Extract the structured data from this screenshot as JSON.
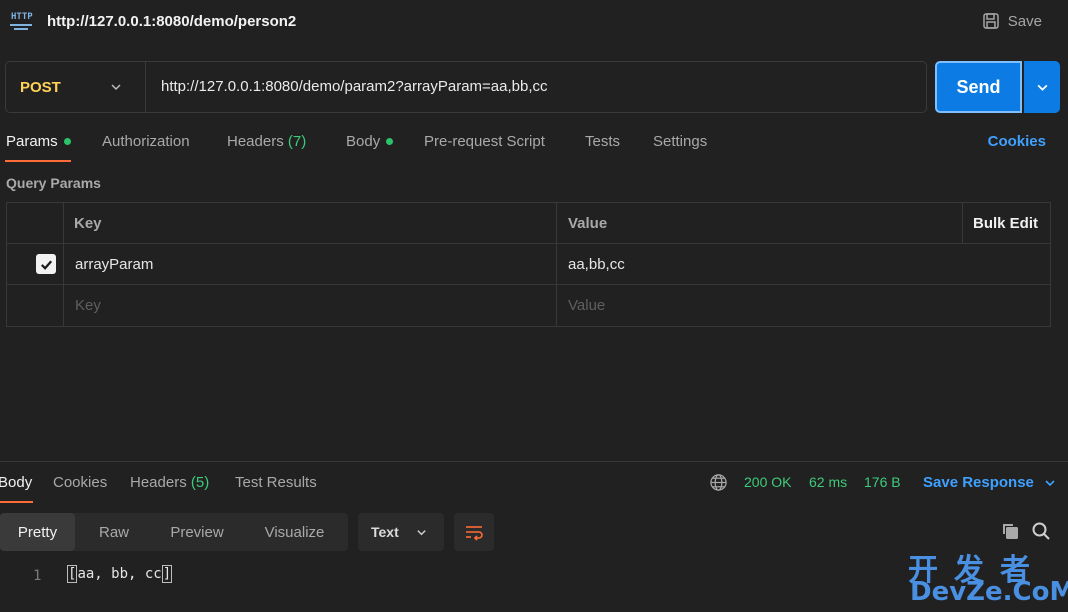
{
  "header": {
    "icon_label": "HTTP",
    "title": "http://127.0.0.1:8080/demo/person2",
    "save_label": "Save"
  },
  "request": {
    "method": "POST",
    "url": "http://127.0.0.1:8080/demo/param2?arrayParam=aa,bb,cc",
    "send_label": "Send"
  },
  "tabs": [
    {
      "label": "Params",
      "dot": true
    },
    {
      "label": "Authorization"
    },
    {
      "label": "Headers",
      "count": "(7)"
    },
    {
      "label": "Body",
      "dot": true
    },
    {
      "label": "Pre-request Script"
    },
    {
      "label": "Tests"
    },
    {
      "label": "Settings"
    }
  ],
  "cookies_label": "Cookies",
  "query_params": {
    "section_label": "Query Params",
    "key_header": "Key",
    "value_header": "Value",
    "bulk_edit_label": "Bulk Edit",
    "rows": [
      {
        "key": "arrayParam",
        "value": "aa,bb,cc",
        "checked": true
      }
    ],
    "key_placeholder": "Key",
    "value_placeholder": "Value"
  },
  "response": {
    "tabs": [
      {
        "label": "Body"
      },
      {
        "label": "Cookies"
      },
      {
        "label": "Headers",
        "count": "(5)"
      },
      {
        "label": "Test Results"
      }
    ],
    "status": "200 OK",
    "time": "62 ms",
    "size": "176 B",
    "save_response_label": "Save Response",
    "views": [
      "Pretty",
      "Raw",
      "Preview",
      "Visualize"
    ],
    "format": "Text",
    "body_line_number": "1",
    "body_open": "[",
    "body_content": "aa, bb, cc",
    "body_close": "]"
  },
  "watermark": {
    "line1": "开发者",
    "line2": "DevZe.CoM"
  },
  "colors": {
    "accent_orange": "#ff6c37",
    "send_blue": "#0c7ce4",
    "link_blue": "#3fa1ff",
    "status_green": "#3ecb7a",
    "method_yellow": "#ffd257"
  }
}
